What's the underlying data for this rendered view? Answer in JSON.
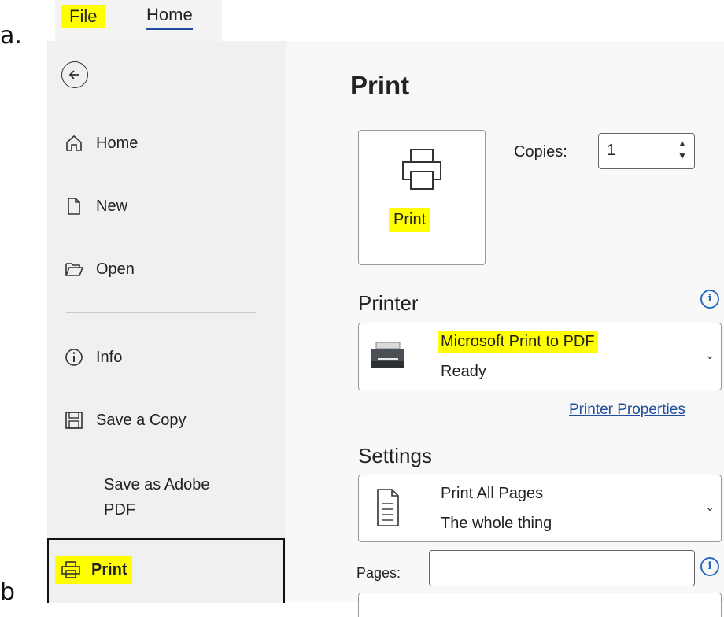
{
  "labels": {
    "a": "a.",
    "b": "b"
  },
  "ribbon": {
    "tabs": [
      {
        "label": "File"
      },
      {
        "label": "Home"
      }
    ]
  },
  "sidebar": {
    "back_icon": "back-arrow-icon",
    "items": [
      {
        "label": "Home",
        "icon": "home-icon"
      },
      {
        "label": "New",
        "icon": "new-document-icon"
      },
      {
        "label": "Open",
        "icon": "folder-open-icon"
      },
      {
        "label": "Info",
        "icon": "info-icon"
      },
      {
        "label": "Save a Copy",
        "icon": "save-icon"
      },
      {
        "label_line1": "Save as Adobe",
        "label_line2": "PDF"
      },
      {
        "label": "Print",
        "icon": "printer-icon"
      }
    ]
  },
  "main": {
    "title": "Print",
    "print_button": {
      "label": "Print"
    },
    "copies": {
      "label": "Copies:",
      "value": "1"
    },
    "printer": {
      "section_label": "Printer",
      "name": "Microsoft Print to PDF",
      "status": "Ready",
      "properties_link": "Printer Properties"
    },
    "settings": {
      "section_label": "Settings",
      "pages_option": {
        "title": "Print All Pages",
        "subtitle": "The whole thing"
      },
      "pages_label": "Pages:",
      "pages_value": ""
    }
  },
  "colors": {
    "highlight": "#ffff00",
    "link": "#1f4e9e",
    "accent": "#2b6cc4"
  }
}
